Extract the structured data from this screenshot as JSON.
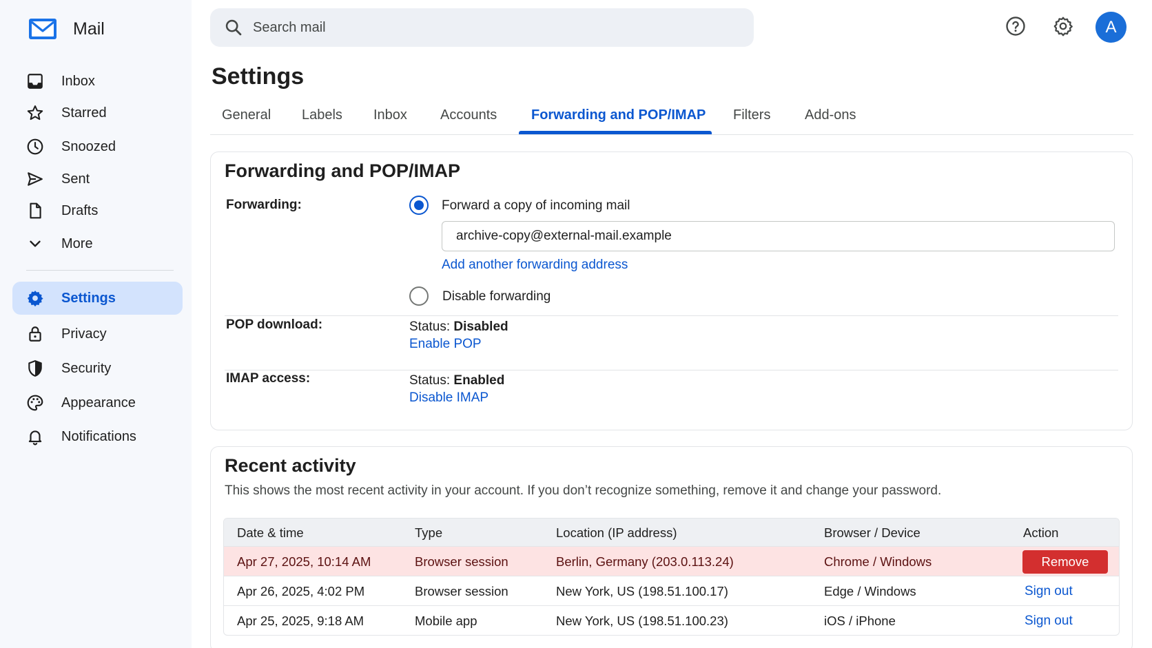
{
  "app": {
    "name": "Mail"
  },
  "search": {
    "placeholder": "Search mail"
  },
  "header": {
    "help_icon": "help-icon",
    "settings_icon": "gear-icon",
    "avatar_letter": "A",
    "avatar_color": "#1a6ed8"
  },
  "sidebar": {
    "items": [
      {
        "label": "Inbox",
        "icon": "inbox-icon"
      },
      {
        "label": "Starred",
        "icon": "star-icon"
      },
      {
        "label": "Snoozed",
        "icon": "clock-icon"
      },
      {
        "label": "Sent",
        "icon": "send-icon"
      },
      {
        "label": "Drafts",
        "icon": "draft-icon"
      },
      {
        "label": "More",
        "icon": "chevron-down-icon"
      },
      {
        "label": "Settings",
        "icon": "gear-icon",
        "active": true
      },
      {
        "label": "Privacy",
        "icon": "lock-icon"
      },
      {
        "label": "Security",
        "icon": "shield-icon"
      },
      {
        "label": "Appearance",
        "icon": "palette-icon"
      },
      {
        "label": "Notifications",
        "icon": "bell-icon"
      }
    ]
  },
  "page": {
    "title": "Settings"
  },
  "tabs": [
    {
      "label": "General"
    },
    {
      "label": "Labels"
    },
    {
      "label": "Inbox"
    },
    {
      "label": "Accounts"
    },
    {
      "label": "Forwarding and POP/IMAP",
      "active": true
    },
    {
      "label": "Filters"
    },
    {
      "label": "Add-ons"
    }
  ],
  "forwarding": {
    "section_title": "Forwarding and POP/IMAP",
    "label": "Forwarding:",
    "option_forward": "Forward a copy of incoming mail",
    "address": "archive-copy@external-mail.example",
    "add_address_link": "Add another forwarding address",
    "option_disable": "Disable forwarding",
    "selected": "forward"
  },
  "pop": {
    "label": "POP download:",
    "status_prefix": "Status: ",
    "status": "Disabled",
    "action": "Enable POP"
  },
  "imap": {
    "label": "IMAP access:",
    "status_prefix": "Status: ",
    "status": "Enabled",
    "action": "Disable IMAP"
  },
  "activity": {
    "title": "Recent activity",
    "description": "This shows the most recent activity in your account. If you don’t recognize something, remove it and change your password.",
    "columns": [
      "Date & time",
      "Type",
      "Location (IP address)",
      "Browser / Device",
      "Action"
    ],
    "rows": [
      {
        "datetime": "Apr 27, 2025, 10:14 AM",
        "type": "Browser session",
        "location": "Berlin, Germany (203.0.113.24)",
        "device": "Chrome / Windows",
        "action": "Remove",
        "highlight": true
      },
      {
        "datetime": "Apr 26, 2025, 4:02 PM",
        "type": "Browser session",
        "location": "New York, US (198.51.100.17)",
        "device": "Edge / Windows",
        "action": "Sign out"
      },
      {
        "datetime": "Apr 25, 2025, 9:18 AM",
        "type": "Mobile app",
        "location": "New York, US (198.51.100.23)",
        "device": "iOS / iPhone",
        "action": "Sign out"
      }
    ]
  },
  "colors": {
    "accent": "#0b57d0",
    "active_nav_bg": "#d3e3fd",
    "alert_row_bg": "#fde3e3",
    "danger": "#d32f2f"
  }
}
